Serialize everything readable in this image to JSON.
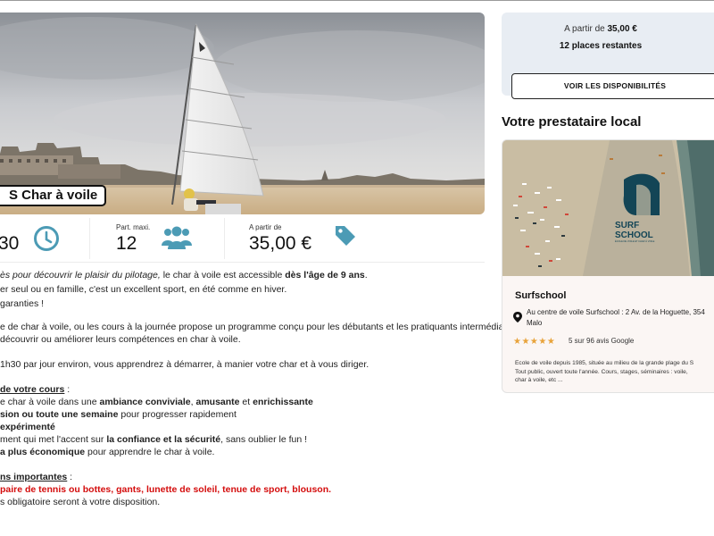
{
  "hero": {
    "title": "S Char à voile"
  },
  "stats": [
    {
      "label": "",
      "value": "30",
      "icon": "clock-icon"
    },
    {
      "label": "Part. maxi.",
      "value": "12",
      "icon": "group-icon"
    },
    {
      "label": "A partir de",
      "value": "35,00 €",
      "icon": "price-tag-icon"
    }
  ],
  "description": {
    "l1a": "ès pour découvrir le plaisir du pilotage, ",
    "l1b": "le char à voile est accessible ",
    "l1c": "dès l'âge de 9 ans",
    "l1d": ".",
    "l2": "er seul ou en famille, c'est un excellent sport, en été comme en hiver.",
    "l3": "garanties !",
    "l4": "e de char à voile, ou les cours à la journée propose un programme conçu pour les débutants et les pratiquants intermédiaires",
    "l5": "découvrir ou améliorer leurs compétences en char à voile.",
    "l6": "1h30 par jour environ, vous apprendrez à démarrer, à manier votre char et à vous diriger.",
    "l7a": "de votre cours",
    "l7b": " :",
    "l8a": "e char à voile dans une ",
    "l8b": "ambiance conviviale",
    "l8c": ", ",
    "l8d": "amusante",
    "l8e": " et ",
    "l8f": "enrichissante",
    "l9a": "sion ou toute une semaine",
    "l9b": " pour progresser rapidement",
    "l10": " expérimenté",
    "l11a": "ment qui met l'accent sur ",
    "l11b": "la confiance et la sécurité",
    "l11c": ", sans oublier le fun !",
    "l12a": "a plus économique",
    "l12b": " pour apprendre le char à voile.",
    "l13a": "ns importantes",
    "l13b": " :",
    "l14": " paire de tennis ou bottes, gants, lunette de soleil, tenue de sport, blouson.",
    "l15": "s obligatoire seront à votre disposition."
  },
  "booking": {
    "price_prefix": "A partir de ",
    "price": "35,00 €",
    "places": "12 places restantes",
    "button": "VOIR LES DISPONIBILITÉS"
  },
  "provider": {
    "section_title": "Votre prestataire local",
    "name": "Surfschool",
    "address_line1": "Au centre de voile Surfschool : 2 Av. de la Hoguette, 354",
    "address_line2": "Malo",
    "stars": "★★★★★",
    "rating": "5 sur 96 avis Google",
    "desc_line1": "Ecole de voile depuis 1985, située au milieu de la grande plage du S",
    "desc_line2": "Tout public, ouvert toute l'année. Cours, stages, séminaires : voile,",
    "desc_line3": "char à voile, etc ...",
    "logo_line1": "SURF",
    "logo_line2": "SCHOOL",
    "logo_tagline": "ÉCOLE DE VOILE ET CHAR À VOILE"
  },
  "colors": {
    "accent_icon": "#4c9bb5",
    "booking_bg": "#e8edf3",
    "star": "#e8a33a",
    "warning_red": "#d40d0d"
  }
}
